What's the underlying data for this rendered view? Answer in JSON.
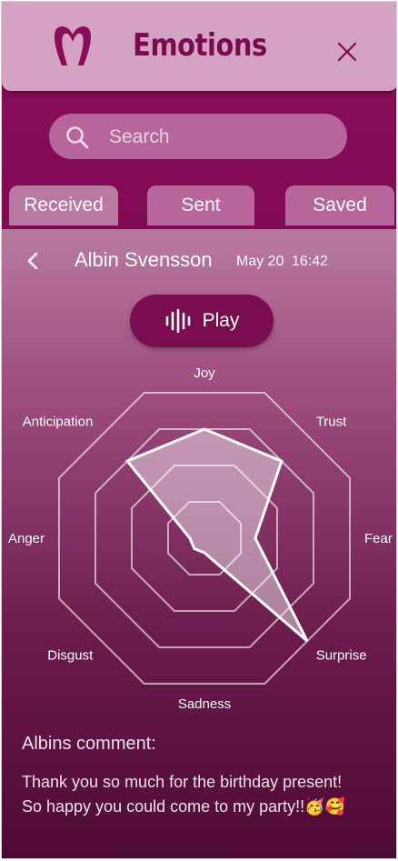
{
  "header": {
    "title": "Emotions",
    "logo_icon": "heart-m-logo-icon",
    "close_icon": "close-icon"
  },
  "search": {
    "placeholder": "Search",
    "value": ""
  },
  "tabs": [
    {
      "label": "Received",
      "active": true
    },
    {
      "label": "Sent",
      "active": false
    },
    {
      "label": "Saved",
      "active": false
    }
  ],
  "message": {
    "sender": "Albin Svensson",
    "date": "May 20",
    "time": "16:42",
    "play_label": "Play",
    "comment_title": "Albins comment:",
    "comment_line1": "Thank you so much for the birthday present!",
    "comment_line2": "So happy you could come to my party!!🥳🥰"
  },
  "chart_data": {
    "type": "radar",
    "axes": [
      "Joy",
      "Trust",
      "Fear",
      "Surprise",
      "Sadness",
      "Disgust",
      "Anger",
      "Anticipation"
    ],
    "rings": 4,
    "values": [
      0.75,
      0.75,
      0.35,
      1.0,
      0.1,
      0.1,
      0.1,
      0.75
    ],
    "colors": {
      "fill": "rgba(255,255,255,0.45)",
      "stroke": "#ffffff",
      "grid": "rgba(255,255,255,0.6)"
    }
  }
}
